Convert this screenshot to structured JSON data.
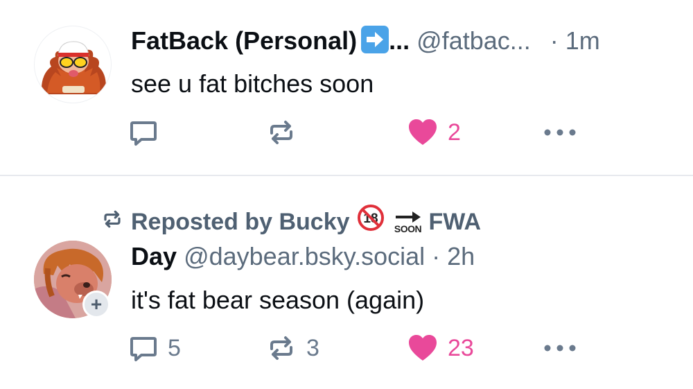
{
  "posts": [
    {
      "display_name": "FatBack (Personal)",
      "name_emoji": "right-arrow-emoji",
      "name_ellipsis": "...",
      "handle": "@fatbac...",
      "time": "· 1m",
      "text": "see u fat bitches soon",
      "actions": {
        "reply_count": "",
        "repost_count": "",
        "like_count": "2"
      },
      "liked": true
    },
    {
      "repost_by_label": "Reposted by Bucky",
      "repost_emojis": [
        "no-one-under-eighteen-emoji",
        "soon-arrow-emoji"
      ],
      "soon_label": "SOON",
      "repost_suffix": "FWA",
      "display_name": "Day",
      "handle": "@daybear.bsky.social",
      "time": "· 2h",
      "text": "it's fat bear season (again)",
      "actions": {
        "reply_count": "5",
        "repost_count": "3",
        "like_count": "23"
      },
      "liked": true
    }
  ],
  "colors": {
    "like": "#e9499a",
    "muted": "#6a7a8d",
    "divider": "#e6e9ee",
    "text": "#0b0f14"
  }
}
